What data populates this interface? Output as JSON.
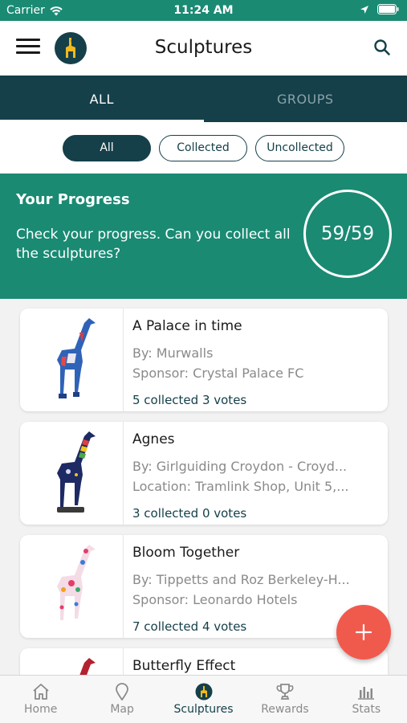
{
  "status_bar": {
    "carrier": "Carrier",
    "time": "11:24 AM",
    "icons": [
      "wifi-icon",
      "location-arrow-icon",
      "battery-icon"
    ]
  },
  "header": {
    "title": "Sculptures",
    "menu_icon": "hamburger-menu-icon",
    "logo_icon": "giraffe-logo-icon",
    "search_icon": "search-icon"
  },
  "tabs": [
    {
      "label": "ALL",
      "active": true
    },
    {
      "label": "GROUPS",
      "active": false
    }
  ],
  "filters": [
    {
      "label": "All",
      "active": true
    },
    {
      "label": "Collected",
      "active": false
    },
    {
      "label": "Uncollected",
      "active": false
    }
  ],
  "progress": {
    "title": "Your Progress",
    "text": "Check your progress. Can you collect all the sculptures?",
    "count": "59/59"
  },
  "sculptures": [
    {
      "name": "A Palace in time",
      "line1": "By: Murwalls",
      "line2": "Sponsor: Crystal Palace FC",
      "stats": "5 collected 3 votes"
    },
    {
      "name": "Agnes",
      "line1": "By: Girlguiding Croydon - Croyd...",
      "line2": "Location: Tramlink Shop, Unit 5,...",
      "stats": "3 collected 0 votes"
    },
    {
      "name": "Bloom Together",
      "line1": "By: Tippetts and Roz Berkeley-H...",
      "line2": "Sponsor: Leonardo Hotels",
      "stats": "7 collected 4 votes"
    },
    {
      "name": "Butterfly Effect",
      "line1": "",
      "line2": "",
      "stats": ""
    }
  ],
  "fab": {
    "icon": "plus-icon"
  },
  "bottom_nav": [
    {
      "label": "Home",
      "icon": "home-icon",
      "active": false
    },
    {
      "label": "Map",
      "icon": "map-pin-icon",
      "active": false
    },
    {
      "label": "Sculptures",
      "icon": "giraffe-logo-icon",
      "active": true
    },
    {
      "label": "Rewards",
      "icon": "trophy-icon",
      "active": false
    },
    {
      "label": "Stats",
      "icon": "bar-chart-icon",
      "active": false
    }
  ],
  "colors": {
    "primary_dark": "#15404a",
    "primary_teal": "#1a8a73",
    "fab_red": "#f05a4d"
  }
}
